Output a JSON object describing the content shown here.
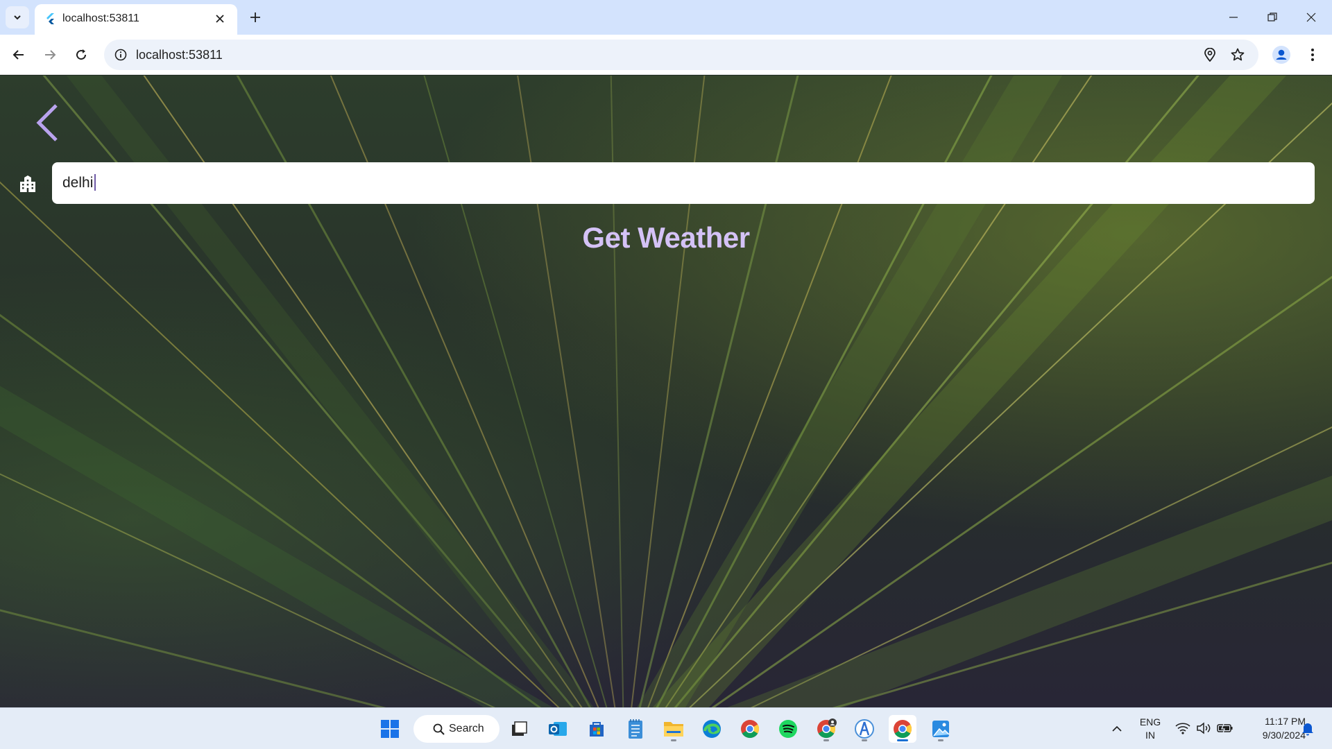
{
  "browser": {
    "tab_title": "localhost:53811",
    "url": "localhost:53811"
  },
  "page": {
    "city_input_value": "delhi",
    "get_weather_label": "Get Weather"
  },
  "taskbar": {
    "search_label": "Search",
    "language_line1": "ENG",
    "language_line2": "IN",
    "time": "11:17 PM",
    "date": "9/30/2024"
  },
  "colors": {
    "accent_purple": "#d4c2f6",
    "back_arrow": "#b9a3ee",
    "tabstrip": "#d3e3fd",
    "taskbar": "#e4ecf7"
  }
}
